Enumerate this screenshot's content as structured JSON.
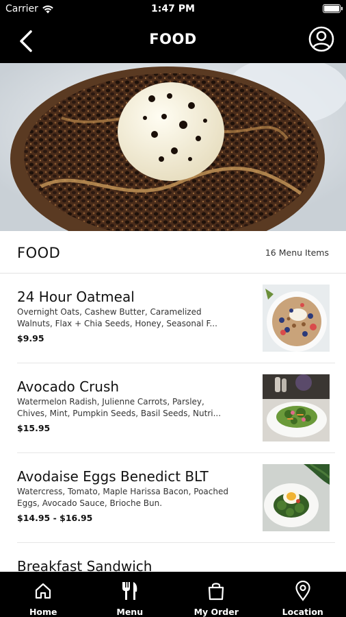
{
  "status_bar": {
    "carrier": "Carrier",
    "time": "1:47 PM"
  },
  "nav": {
    "title": "FOOD",
    "back_icon": "chevron-left-icon",
    "profile_icon": "user-circle-icon"
  },
  "hero": {
    "icon": "chocolate-dessert-photo"
  },
  "section": {
    "name": "FOOD",
    "count": "16 Menu Items"
  },
  "menu_items": [
    {
      "name": "24 Hour Oatmeal",
      "description": "Overnight Oats, Cashew Butter, Caramelized Walnuts, Flax + Chia Seeds, Honey, Seasonal F...",
      "price": "$9.95",
      "thumb_icon": "oatmeal-bowl-photo"
    },
    {
      "name": "Avocado Crush",
      "description": "Watermelon Radish, Julienne Carrots, Parsley, Chives, Mint, Pumpkin Seeds, Basil Seeds, Nutri...",
      "price": "$15.95",
      "thumb_icon": "avocado-toast-photo"
    },
    {
      "name": "Avodaise Eggs Benedict BLT",
      "description": "Watercress, Tomato, Maple Harissa Bacon, Poached Eggs, Avocado Sauce, Brioche Bun.",
      "price": "$14.95 - $16.95",
      "thumb_icon": "eggs-benedict-photo"
    },
    {
      "name": "Breakfast Sandwich",
      "description": "",
      "price": "",
      "thumb_icon": ""
    }
  ],
  "tabs": [
    {
      "label": "Home",
      "icon": "home-icon"
    },
    {
      "label": "Menu",
      "icon": "fork-knife-icon"
    },
    {
      "label": "My Order",
      "icon": "shopping-bag-icon"
    },
    {
      "label": "Location",
      "icon": "map-pin-icon"
    }
  ],
  "colors": {
    "bar_background": "#000000",
    "bar_foreground": "#ffffff",
    "divider": "#e2e2e2"
  }
}
